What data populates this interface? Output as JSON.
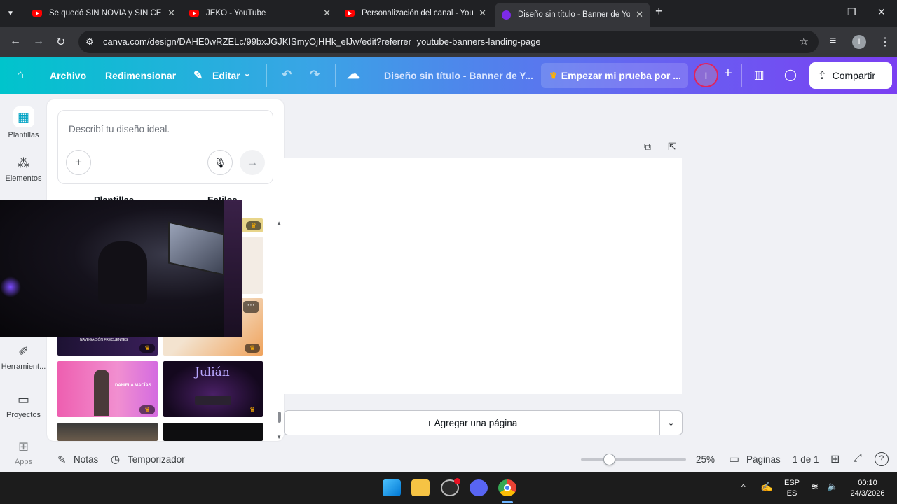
{
  "browser": {
    "tabs": [
      {
        "title": "Se quedó SIN NOVIA y SIN CEL",
        "icon": "youtube-icon"
      },
      {
        "title": "JEKO - YouTube",
        "icon": "youtube-icon"
      },
      {
        "title": "Personalización del canal - YouTube",
        "icon": "youtube-icon"
      },
      {
        "title": "Diseño sin título - Banner de YouTube",
        "icon": "canva-icon",
        "active": true
      }
    ],
    "url": "canva.com/design/DAHE0wRZELc/99bxJGJKISmyOjHHk_elJw/edit?referrer=youtube-banners-landing-page",
    "profile_initial": "I"
  },
  "header": {
    "archivo": "Archivo",
    "redimensionar": "Redimensionar",
    "editar": "Editar",
    "doc_title": "Diseño sin título - Banner de Y...",
    "trial": "Empezar mi prueba por ...",
    "avatar": "I",
    "share": "Compartir",
    "accent_color": "#7b3ff2"
  },
  "sidebar": {
    "items": [
      {
        "label": "Plantillas",
        "icon": "templates-icon"
      },
      {
        "label": "Elementos",
        "icon": "elements-icon"
      },
      {
        "label": "Herramient...",
        "icon": "tools-icon"
      },
      {
        "label": "Proyectos",
        "icon": "folder-icon"
      },
      {
        "label": "Apps",
        "icon": "apps-icon"
      }
    ]
  },
  "panel": {
    "describe_placeholder": "Describí tu diseño ideal.",
    "tab_templates": "Plantillas",
    "tab_styles": "Estilos",
    "thumb_text_1": "DANIELA MACÍAS",
    "thumb_text_2": "Julián",
    "thumb_text_3": "NAVEGACIÓN FRECUENTES"
  },
  "canvas": {
    "add_page": "+ Agregar una página"
  },
  "footer": {
    "notes": "Notas",
    "timer": "Temporizador",
    "zoom": "25%",
    "zoom_level": 0.25,
    "pages": "Páginas",
    "page_count": "1 de 1"
  },
  "taskbar": {
    "lang_top": "ESP",
    "lang_bottom": "ES",
    "time": "00:10",
    "date": "24/3/2026"
  }
}
